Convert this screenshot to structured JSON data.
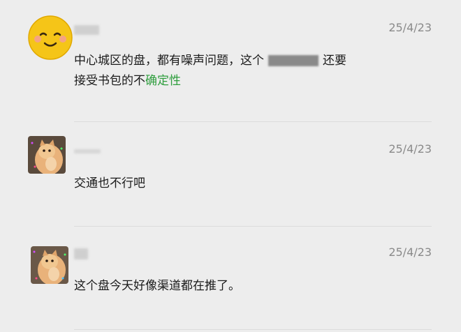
{
  "comments": [
    {
      "date": "25/4/23",
      "text_before": "中心城区的盘，都有噪声问题，这个",
      "text_after": "还要",
      "text_line2_plain": "接受书包的不",
      "text_line2_highlight": "确定性"
    },
    {
      "date": "25/4/23",
      "text": "交通也不行吧"
    },
    {
      "date": "25/4/23",
      "text": "这个盘今天好像渠道都在推了。"
    }
  ],
  "colors": {
    "background": "#ededed",
    "highlight": "#2f9e3e",
    "date": "#8a8a8a",
    "emoji_face": "#f5c518"
  },
  "icons": {
    "avatar1": "smiley-face-icon",
    "avatar2": "cat-photo-avatar",
    "avatar3": "cat-photo-avatar"
  }
}
